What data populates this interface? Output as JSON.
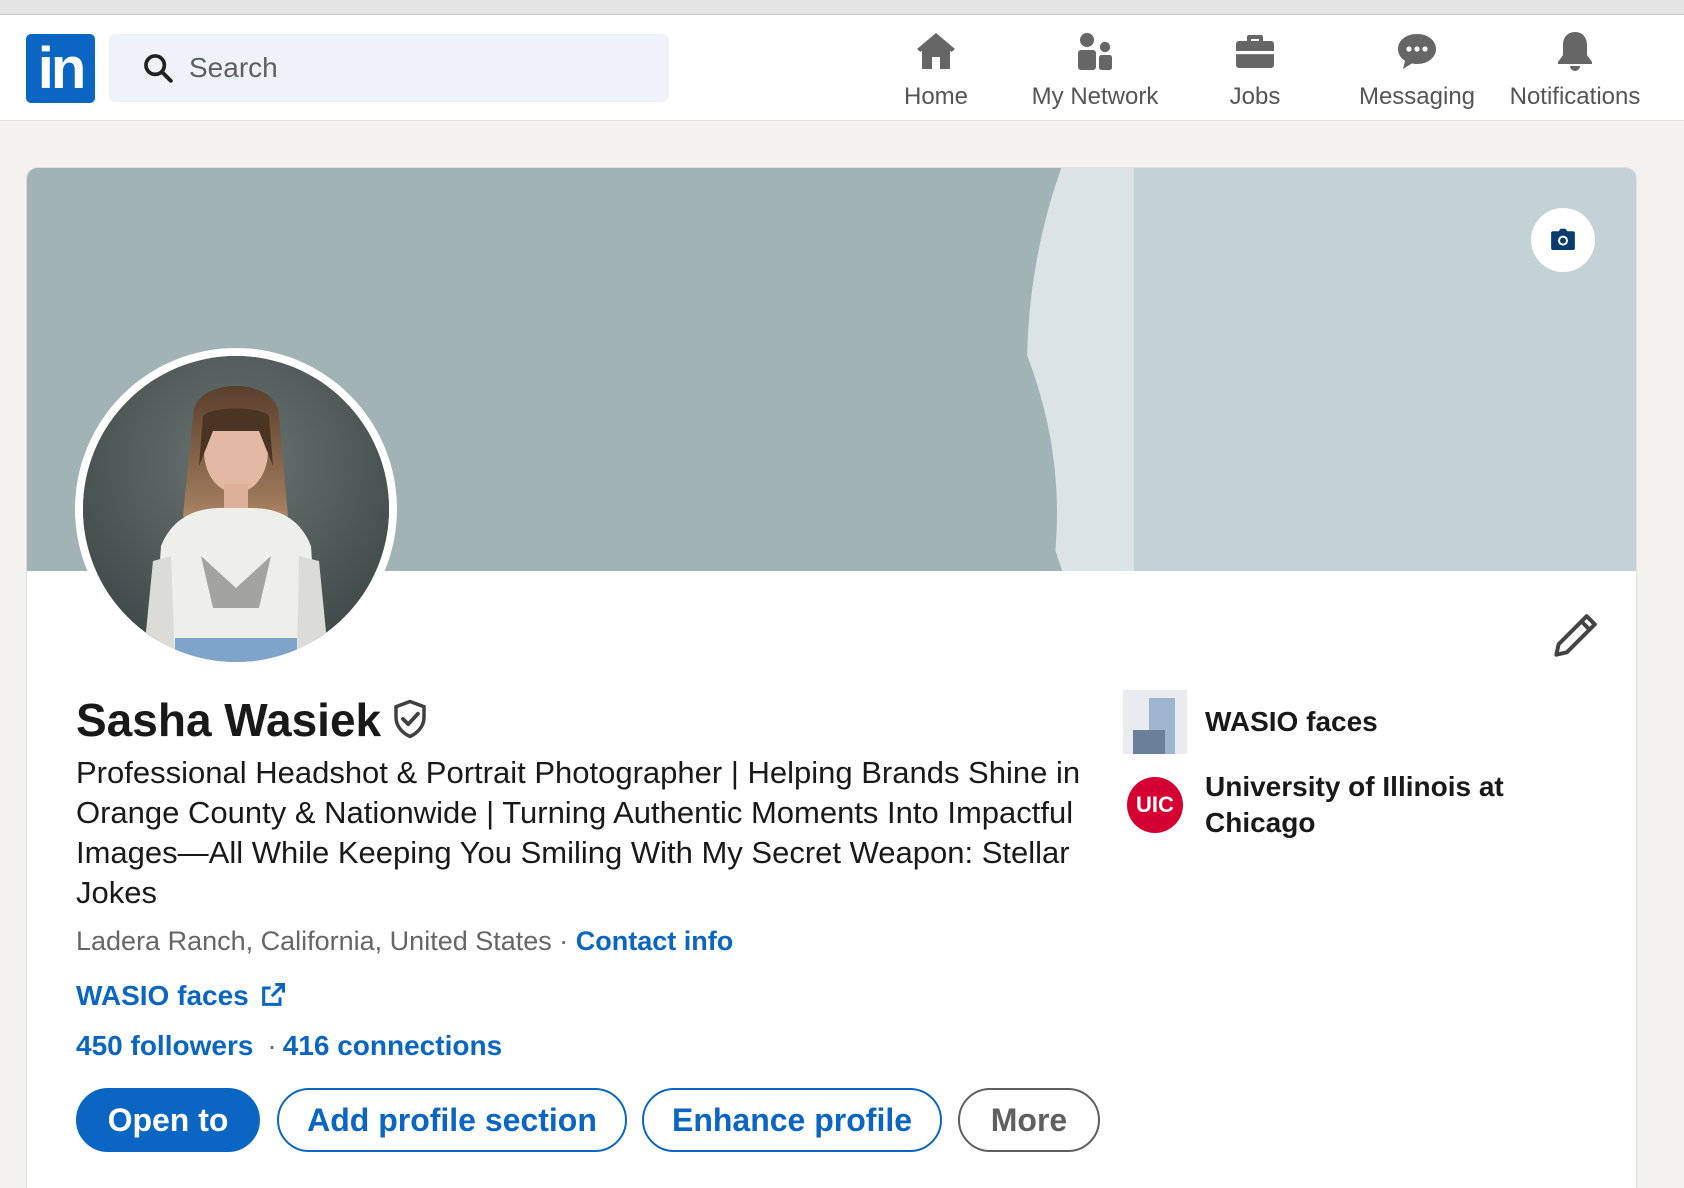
{
  "app": {
    "logo_text": "in",
    "brand_color": "#0a66c2"
  },
  "search": {
    "placeholder": "Search"
  },
  "nav": {
    "items": [
      {
        "label": "Home",
        "icon": "home-icon"
      },
      {
        "label": "My Network",
        "icon": "network-icon"
      },
      {
        "label": "Jobs",
        "icon": "briefcase-icon"
      },
      {
        "label": "Messaging",
        "icon": "chat-icon"
      },
      {
        "label": "Notifications",
        "icon": "bell-icon"
      }
    ]
  },
  "profile": {
    "name": "Sasha Wasiek",
    "headline": "Professional Headshot & Portrait Photographer | Helping Brands Shine in Orange County & Nationwide | Turning Authentic Moments Into Impactful Images—All While Keeping You Smiling With My Secret Weapon: Stellar Jokes",
    "location": "Ladera Ranch, California, United States",
    "location_separator": " · ",
    "contact_label": "Contact info",
    "website": "WASIO faces",
    "followers": "450 followers",
    "stats_separator": "·",
    "connections": "416 connections"
  },
  "actions": {
    "open_to": "Open to",
    "add_section": "Add profile section",
    "enhance": "Enhance profile",
    "more": "More"
  },
  "sidebar": {
    "company": "WASIO faces",
    "school": "University of Illinois at Chicago",
    "school_logo_text": "UIC"
  }
}
